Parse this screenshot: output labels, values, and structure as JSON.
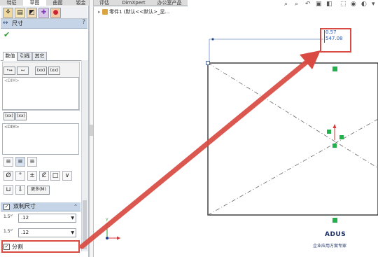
{
  "top_tabs": [
    "特征",
    "草图",
    "曲面",
    "钣金",
    "评估",
    "DimXpert",
    "办公室产品"
  ],
  "active_top_tab": 1,
  "property_manager": {
    "title": "尺寸",
    "subtabs": [
      "数值",
      "引线",
      "其它"
    ],
    "leader_buttons": [
      "(xx)",
      "(xx)"
    ],
    "text_box_placeholder": "<DIM>",
    "text_box2_value": "<DIM>",
    "format_buttons": [
      "(xx)",
      "(xx)"
    ],
    "symbol_buttons": [
      "Ø",
      "°",
      "±",
      "Ȼ",
      "□",
      "∨"
    ],
    "more_button": "更多(M)",
    "dual_dimension_label": "双制尺寸",
    "precision_primary": ".12",
    "precision_secondary": ".12",
    "split_label": "分割",
    "split_checked": true,
    "dual_checked": true
  },
  "tree": {
    "label": "零件1 (默认<<默认>_显..."
  },
  "dimension": {
    "primary": "0.57",
    "secondary": "547.08"
  },
  "logo": {
    "name": "ADUS",
    "subtitle": "企业应用方案专家"
  },
  "colors": {
    "highlight": "#d94a42",
    "arrow": "#d94a42",
    "dimension_text": "#2a5ab4",
    "relation_marker": "#22b14c"
  }
}
